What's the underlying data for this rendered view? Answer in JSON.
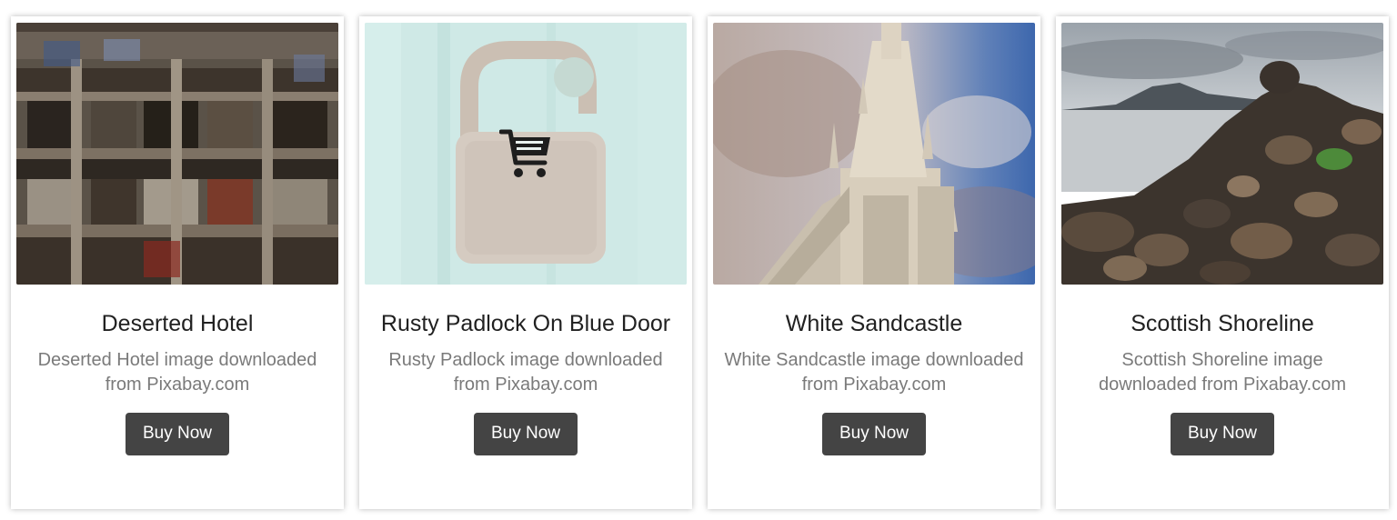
{
  "products": [
    {
      "title": "Deserted Hotel",
      "description": "Deserted Hotel image downloaded from Pixabay.com",
      "button_label": "Buy Now"
    },
    {
      "title": "Rusty Padlock On Blue Door",
      "description": "Rusty Padlock image downloaded from Pixabay.com",
      "button_label": "Buy Now",
      "hover_icon": "shopping-cart-icon"
    },
    {
      "title": "White Sandcastle",
      "description": "White Sandcastle image downloaded from Pixabay.com",
      "button_label": "Buy Now"
    },
    {
      "title": "Scottish Shoreline",
      "description": "Scottish Shoreline image downloaded from Pixabay.com",
      "button_label": "Buy Now"
    }
  ],
  "colors": {
    "button_bg": "#444444",
    "button_text": "#ffffff",
    "title_text": "#212121",
    "desc_text": "#7a7a7a"
  }
}
